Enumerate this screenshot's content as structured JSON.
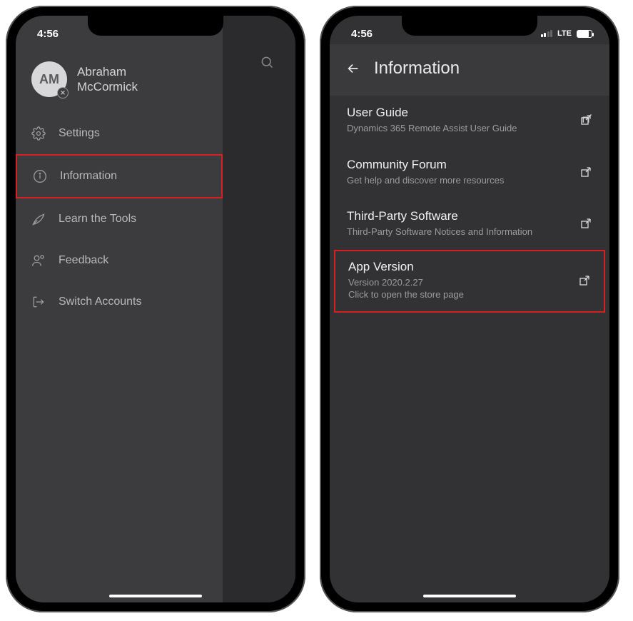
{
  "statusbar": {
    "time": "4:56",
    "network": "LTE"
  },
  "phone1": {
    "avatar_initials": "AM",
    "name_line1": "Abraham",
    "name_line2": "McCormick",
    "menu": {
      "settings": "Settings",
      "information": "Information",
      "learn": "Learn the Tools",
      "feedback": "Feedback",
      "switch": "Switch Accounts"
    }
  },
  "phone2": {
    "header_title": "Information",
    "items": {
      "user_guide": {
        "title": "User Guide",
        "sub": "Dynamics 365 Remote Assist User Guide"
      },
      "forum": {
        "title": "Community Forum",
        "sub": "Get help and discover more resources"
      },
      "third_party": {
        "title": "Third-Party Software",
        "sub": "Third-Party Software Notices and Information"
      },
      "version": {
        "title": "App Version",
        "sub1": "Version 2020.2.27",
        "sub2": "Click to open the store page"
      }
    }
  }
}
